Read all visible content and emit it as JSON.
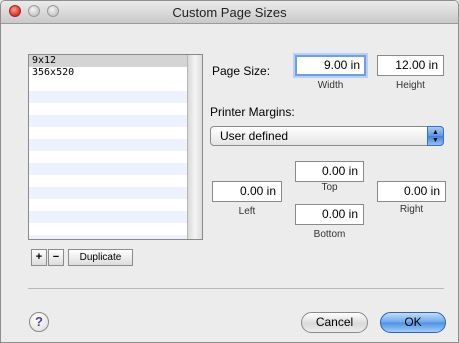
{
  "window": {
    "title": "Custom Page Sizes"
  },
  "sizes_list": {
    "items": [
      {
        "label": "9x12",
        "selected": true
      },
      {
        "label": "356x520",
        "selected": false
      }
    ]
  },
  "list_buttons": {
    "add": "+",
    "remove": "−",
    "duplicate": "Duplicate"
  },
  "page_size": {
    "label": "Page Size:",
    "width_value": "9.00 in",
    "width_label": "Width",
    "height_value": "12.00 in",
    "height_label": "Height"
  },
  "printer_margins": {
    "label": "Printer Margins:",
    "popup_value": "User defined",
    "top_value": "0.00 in",
    "top_label": "Top",
    "left_value": "0.00 in",
    "left_label": "Left",
    "right_value": "0.00 in",
    "right_label": "Right",
    "bottom_value": "0.00 in",
    "bottom_label": "Bottom"
  },
  "footer": {
    "help": "?",
    "cancel": "Cancel",
    "ok": "OK"
  },
  "colors": {
    "accent": "#5b97e3",
    "focus_ring": "#6f9ee8",
    "close_button": "#d6322a",
    "stripe": "#edf3fe"
  }
}
